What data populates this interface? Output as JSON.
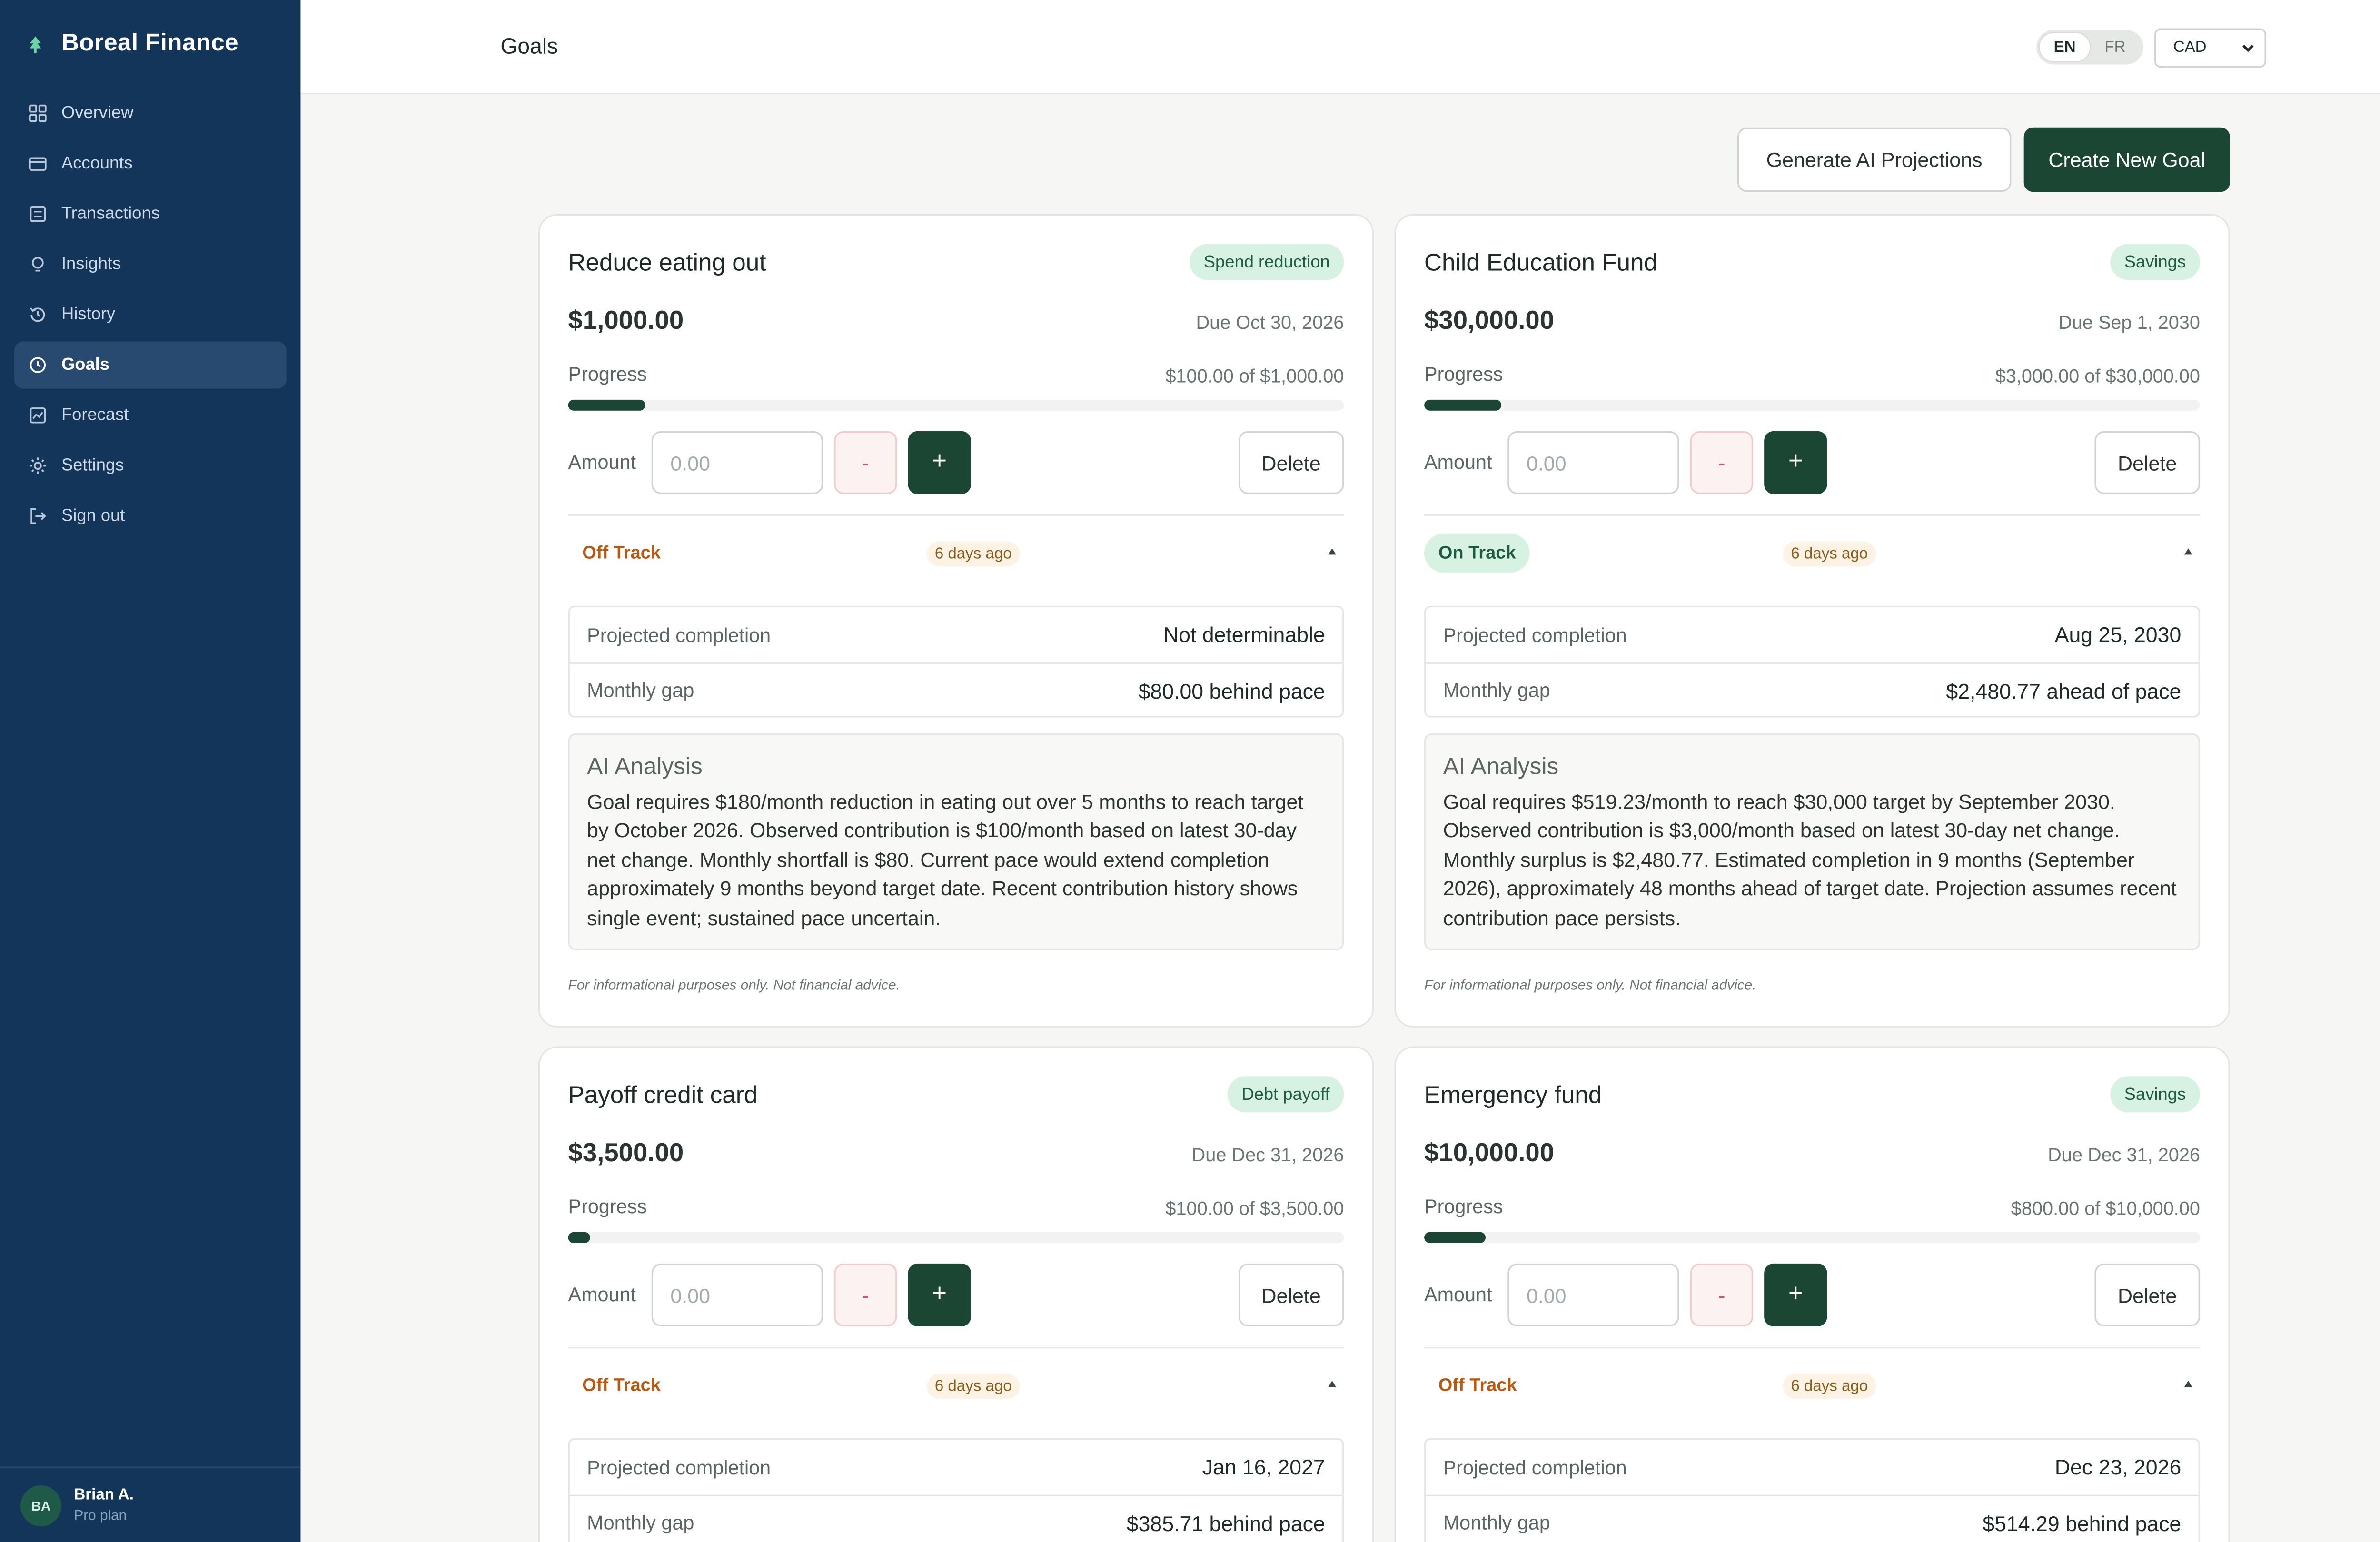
{
  "app": {
    "name": "Boreal Finance"
  },
  "sidebar": {
    "items": [
      {
        "label": "Overview",
        "icon": "grid-icon",
        "active": false
      },
      {
        "label": "Accounts",
        "icon": "wallet-icon",
        "active": false
      },
      {
        "label": "Transactions",
        "icon": "list-icon",
        "active": false
      },
      {
        "label": "Insights",
        "icon": "lightbulb-icon",
        "active": false
      },
      {
        "label": "History",
        "icon": "history-icon",
        "active": false
      },
      {
        "label": "Goals",
        "icon": "target-icon",
        "active": true
      },
      {
        "label": "Forecast",
        "icon": "chart-icon",
        "active": false
      },
      {
        "label": "Settings",
        "icon": "gear-icon",
        "active": false
      },
      {
        "label": "Sign out",
        "icon": "sign-out-icon",
        "active": false
      }
    ],
    "user": {
      "initials": "BA",
      "name": "Brian A.",
      "plan": "Pro plan"
    }
  },
  "header": {
    "title": "Goals",
    "languages": [
      "EN",
      "FR"
    ],
    "active_language": "EN",
    "currency": "CAD"
  },
  "actions": {
    "generate_label": "Generate AI Projections",
    "create_label": "Create New Goal"
  },
  "goals": [
    {
      "title": "Reduce eating out",
      "tag": "Spend reduction",
      "target": "$1,000.00",
      "due": "Due Oct 30, 2026",
      "progress_label": "Progress",
      "progress_text": "$100.00 of $1,000.00",
      "progress_pct": 10,
      "amount_label": "Amount",
      "amount_placeholder": "0.00",
      "minus": "-",
      "plus": "+",
      "delete": "Delete",
      "status": "Off Track",
      "status_kind": "off",
      "updated": "6 days ago",
      "projected_label": "Projected completion",
      "projected_value": "Not determinable",
      "gap_label": "Monthly gap",
      "gap_value": "$80.00 behind pace",
      "analysis_title": "AI Analysis",
      "analysis_text": "Goal requires $180/month reduction in eating out over 5 months to reach target by October 2026. Observed contribution is $100/month based on latest 30-day net change. Monthly shortfall is $80. Current pace would extend completion approximately 9 months beyond target date. Recent contribution history shows single event; sustained pace uncertain.",
      "disclaimer": "For informational purposes only. Not financial advice."
    },
    {
      "title": "Child Education Fund",
      "tag": "Savings",
      "target": "$30,000.00",
      "due": "Due Sep 1, 2030",
      "progress_label": "Progress",
      "progress_text": "$3,000.00 of $30,000.00",
      "progress_pct": 10,
      "amount_label": "Amount",
      "amount_placeholder": "0.00",
      "minus": "-",
      "plus": "+",
      "delete": "Delete",
      "status": "On Track",
      "status_kind": "on",
      "updated": "6 days ago",
      "projected_label": "Projected completion",
      "projected_value": "Aug 25, 2030",
      "gap_label": "Monthly gap",
      "gap_value": "$2,480.77 ahead of pace",
      "analysis_title": "AI Analysis",
      "analysis_text": "Goal requires $519.23/month to reach $30,000 target by September 2030. Observed contribution is $3,000/month based on latest 30-day net change. Monthly surplus is $2,480.77. Estimated completion in 9 months (September 2026), approximately 48 months ahead of target date. Projection assumes recent contribution pace persists.",
      "disclaimer": "For informational purposes only. Not financial advice."
    },
    {
      "title": "Payoff credit card",
      "tag": "Debt payoff",
      "target": "$3,500.00",
      "due": "Due Dec 31, 2026",
      "progress_label": "Progress",
      "progress_text": "$100.00 of $3,500.00",
      "progress_pct": 2.86,
      "amount_label": "Amount",
      "amount_placeholder": "0.00",
      "minus": "-",
      "plus": "+",
      "delete": "Delete",
      "status": "Off Track",
      "status_kind": "off",
      "updated": "6 days ago",
      "projected_label": "Projected completion",
      "projected_value": "Jan 16, 2027",
      "gap_label": "Monthly gap",
      "gap_value": "$385.71 behind pace"
    },
    {
      "title": "Emergency fund",
      "tag": "Savings",
      "target": "$10,000.00",
      "due": "Due Dec 31, 2026",
      "progress_label": "Progress",
      "progress_text": "$800.00 of $10,000.00",
      "progress_pct": 8,
      "amount_label": "Amount",
      "amount_placeholder": "0.00",
      "minus": "-",
      "plus": "+",
      "delete": "Delete",
      "status": "Off Track",
      "status_kind": "off",
      "updated": "6 days ago",
      "projected_label": "Projected completion",
      "projected_value": "Dec 23, 2026",
      "gap_label": "Monthly gap",
      "gap_value": "$514.29 behind pace"
    }
  ]
}
